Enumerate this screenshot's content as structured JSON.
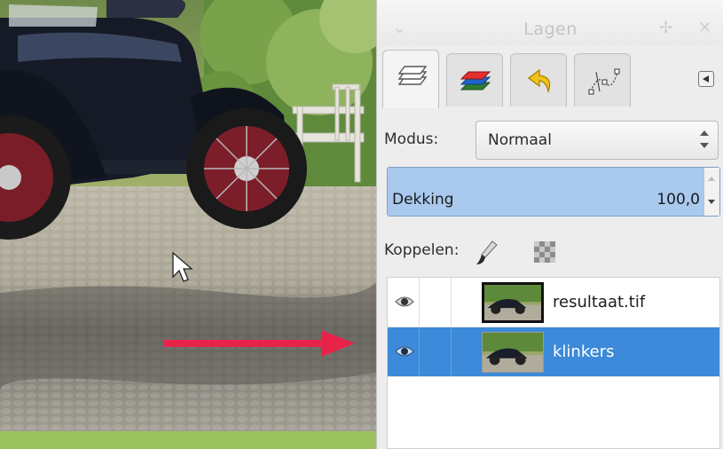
{
  "panel": {
    "title": "Lagen",
    "tabs": [
      {
        "icon": "layers-icon",
        "active": true
      },
      {
        "icon": "channels-icon",
        "active": false
      },
      {
        "icon": "undo-history-icon",
        "active": false
      },
      {
        "icon": "paths-icon",
        "active": false
      }
    ],
    "mode_label": "Modus:",
    "mode_value": "Normaal",
    "opacity_label": "Dekking",
    "opacity_value": "100,0",
    "lock_label": "Koppelen:",
    "layers": [
      {
        "name": "resultaat.tif",
        "visible": true,
        "selected": false
      },
      {
        "name": "klinkers",
        "visible": true,
        "selected": true
      }
    ]
  },
  "colors": {
    "selection": "#3c8ad9",
    "opacity_fill": "#a9c9ee",
    "arrow": "#e8234a"
  }
}
